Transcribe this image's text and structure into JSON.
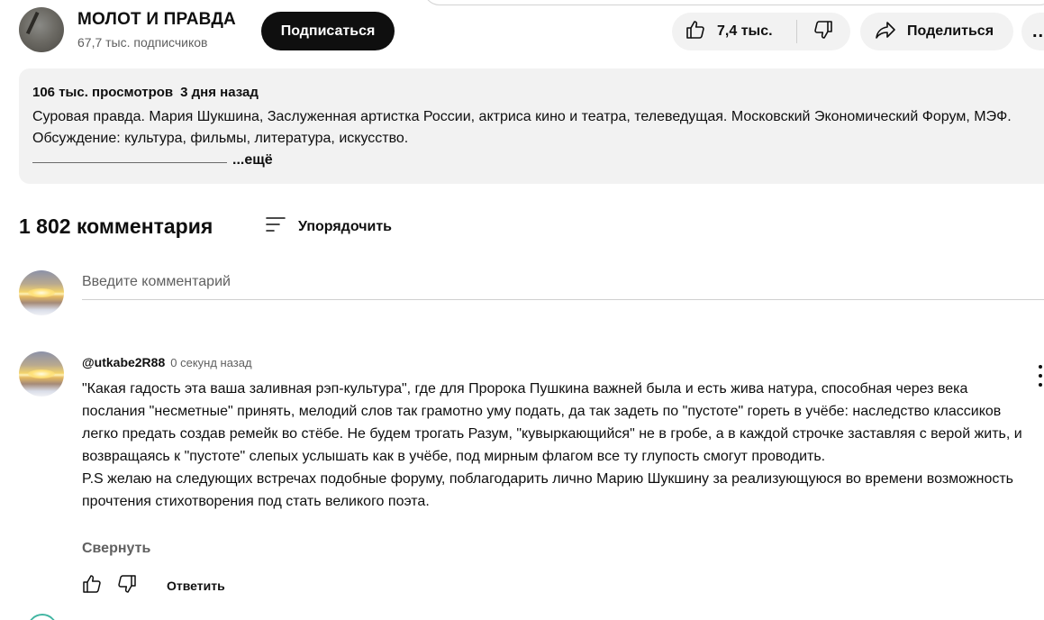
{
  "channel": {
    "name": "МОЛОТ И ПРАВДА",
    "subscribers": "67,7 тыс. подписчиков",
    "subscribe_label": "Подписаться"
  },
  "actions": {
    "like_count": "7,4 тыс.",
    "share_label": "Поделиться",
    "more_label": "..."
  },
  "description": {
    "views": "106 тыс. просмотров",
    "date": "3 дня назад",
    "text": "Суровая правда. Мария Шукшина, Заслуженная артистка России, актриса кино и театра, телеведущая. Московский Экономический Форум, МЭФ. Обсуждение: культура, фильмы, литература, искусство.",
    "more_label": "...ещё"
  },
  "comments": {
    "count_label": "1 802 комментария",
    "sort_label": "Упорядочить",
    "input_placeholder": "Введите комментарий",
    "items": [
      {
        "author": "@utkabe2R88",
        "time": "0 секунд назад",
        "paragraph_1": "\"Какая гадость эта ваша заливная рэп-культура\", где для Пророка Пушкина важней была и есть жива натура, способная через века послания \"несметные\" принять, мелодий слов так грамотно уму подать, да так задеть по \"пустоте\" гореть в учёбе: наследство классиков легко предать создав ремейк во стёбе. Не будем трогать Разум, \"кувыркающийся\" не в гробе, а в каждой строчке заставляя с верой жить, и возвращаясь к \"пустоте\" слепых услышать как в учёбе, под мирным флагом все ту глупость смогут проводить.",
        "paragraph_2": "P.S желаю на следующих встречах подобные форуму, поблагодарить лично Марию Шукшину за реализующуюся во времени возможность прочтения стихотворения под стать великого поэта.",
        "collapse_label": "Свернуть",
        "reply_label": "Ответить"
      }
    ]
  },
  "colors": {
    "subscribe_bg": "#0f0f0f",
    "pill_bg": "#f2f2f2",
    "secondary_text": "#606060"
  },
  "icons": [
    "thumbs-up-icon",
    "thumbs-down-icon",
    "share-arrow-icon",
    "sort-icon",
    "kebab-menu-icon"
  ]
}
